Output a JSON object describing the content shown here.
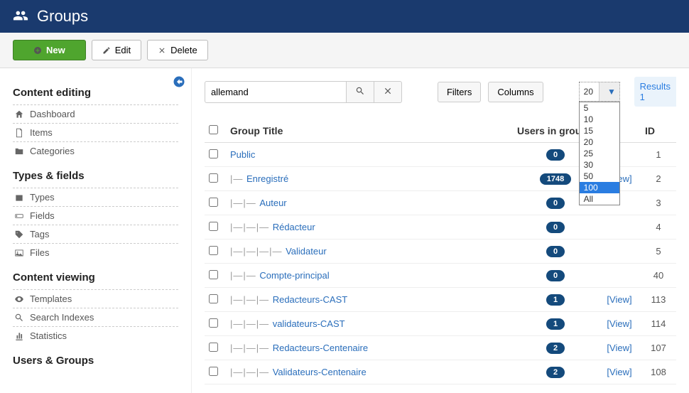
{
  "header": {
    "title": "Groups"
  },
  "toolbar": {
    "new": "New",
    "edit": "Edit",
    "delete": "Delete"
  },
  "sidebar": {
    "sections": [
      {
        "title": "Content editing",
        "items": [
          {
            "icon": "home",
            "label": "Dashboard"
          },
          {
            "icon": "doc",
            "label": "Items"
          },
          {
            "icon": "folder",
            "label": "Categories"
          }
        ]
      },
      {
        "title": "Types & fields",
        "items": [
          {
            "icon": "briefcase",
            "label": "Types"
          },
          {
            "icon": "input",
            "label": "Fields"
          },
          {
            "icon": "tag",
            "label": "Tags"
          },
          {
            "icon": "image",
            "label": "Files"
          }
        ]
      },
      {
        "title": "Content viewing",
        "items": [
          {
            "icon": "eye",
            "label": "Templates"
          },
          {
            "icon": "search",
            "label": "Search Indexes"
          },
          {
            "icon": "chart",
            "label": "Statistics"
          }
        ]
      },
      {
        "title": "Users & Groups",
        "items": []
      }
    ]
  },
  "search": {
    "value": "allemand"
  },
  "buttons": {
    "filters": "Filters",
    "columns": "Columns"
  },
  "pagesize": {
    "current": "20",
    "options": [
      "5",
      "10",
      "15",
      "20",
      "25",
      "30",
      "50",
      "100",
      "All"
    ],
    "highlighted": "100"
  },
  "results_label": "Results 1",
  "table": {
    "headers": {
      "title": "Group Title",
      "users": "Users in group",
      "id": "ID"
    },
    "view_label": "[View]",
    "rows": [
      {
        "depth": 0,
        "name": "Public",
        "count": "0",
        "view": false,
        "id": "1"
      },
      {
        "depth": 1,
        "name": "Enregistré",
        "count": "1748",
        "view": true,
        "id": "2"
      },
      {
        "depth": 2,
        "name": "Auteur",
        "count": "0",
        "view": false,
        "id": "3"
      },
      {
        "depth": 3,
        "name": "Rédacteur",
        "count": "0",
        "view": false,
        "id": "4"
      },
      {
        "depth": 4,
        "name": "Validateur",
        "count": "0",
        "view": false,
        "id": "5"
      },
      {
        "depth": 2,
        "name": "Compte-principal",
        "count": "0",
        "view": false,
        "id": "40"
      },
      {
        "depth": 3,
        "name": "Redacteurs-CAST",
        "count": "1",
        "view": true,
        "id": "113"
      },
      {
        "depth": 3,
        "name": "validateurs-CAST",
        "count": "1",
        "view": true,
        "id": "114"
      },
      {
        "depth": 3,
        "name": "Redacteurs-Centenaire",
        "count": "2",
        "view": true,
        "id": "107"
      },
      {
        "depth": 3,
        "name": "Validateurs-Centenaire",
        "count": "2",
        "view": true,
        "id": "108"
      }
    ]
  }
}
